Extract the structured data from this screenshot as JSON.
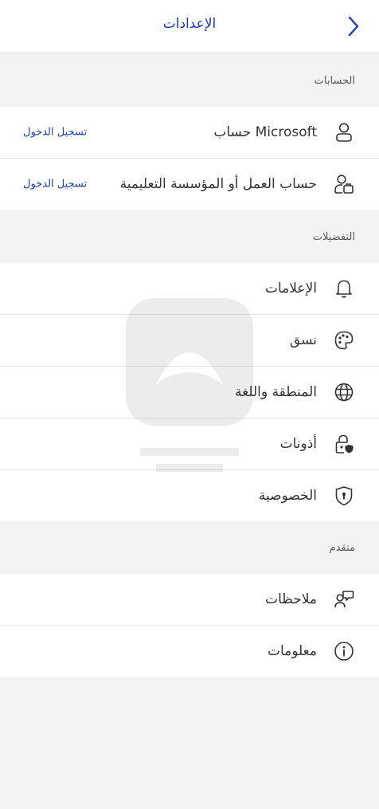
{
  "header": {
    "title": "الإعدادات"
  },
  "accounts": {
    "heading": "الحسابات",
    "items": [
      {
        "label": "حساب Microsoft",
        "action": "تسجيل الدخول",
        "icon": "person-icon"
      },
      {
        "label": "حساب العمل أو المؤسسة التعليمية",
        "action": "تسجيل الدخول",
        "icon": "work-account-icon"
      }
    ]
  },
  "preferences": {
    "heading": "التفضيلات",
    "items": [
      {
        "label": "الإعلامات",
        "icon": "bell-icon"
      },
      {
        "label": "نسق",
        "icon": "palette-icon"
      },
      {
        "label": "المنطقة واللغة",
        "icon": "globe-icon"
      },
      {
        "label": "أذونات",
        "icon": "lock-shield-icon"
      },
      {
        "label": "الخصوصية",
        "icon": "shield-icon"
      }
    ]
  },
  "advanced": {
    "heading": "متقدم",
    "items": [
      {
        "label": "ملاحظات",
        "icon": "feedback-icon"
      },
      {
        "label": "معلومات",
        "icon": "info-icon"
      }
    ]
  },
  "colors": {
    "accent": "#1a3bb5",
    "background": "#f3f3f3",
    "surface": "#ffffff"
  }
}
